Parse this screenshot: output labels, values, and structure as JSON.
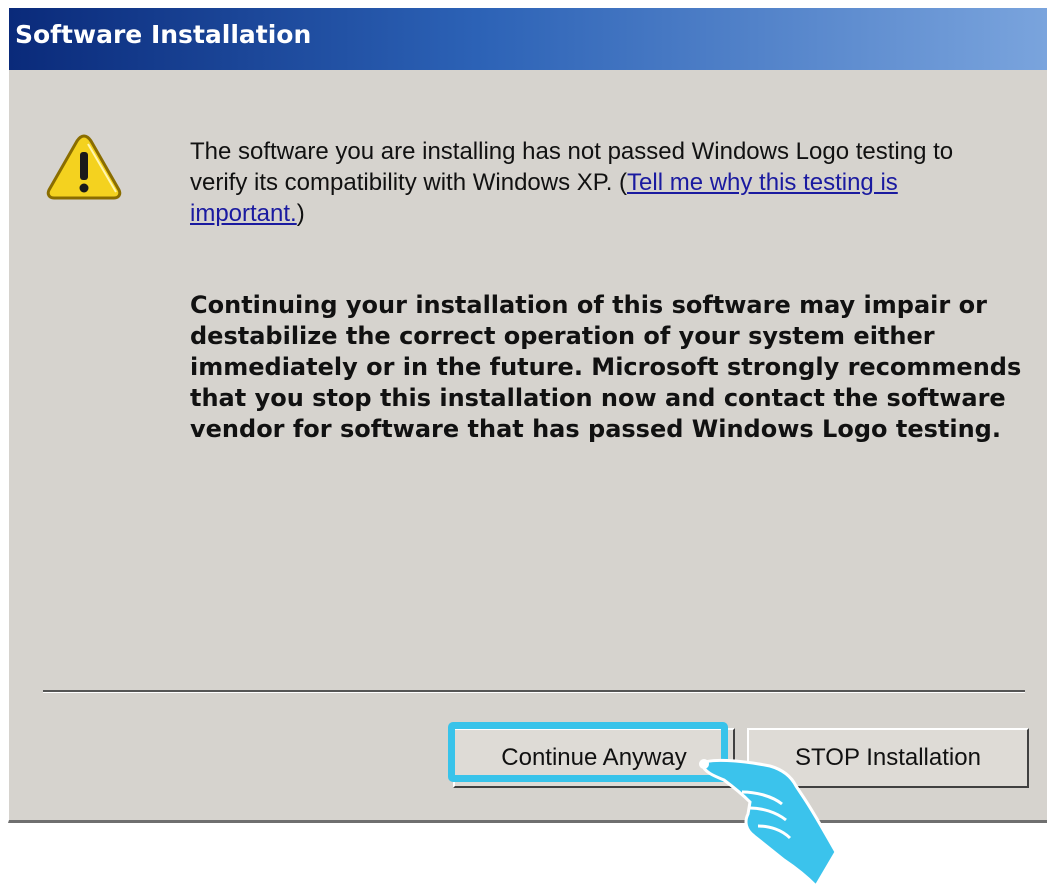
{
  "dialog": {
    "title": "Software Installation",
    "message_text": "The software you are installing has not passed Windows Logo testing to verify its compatibility with Windows XP. (",
    "message_link": "Tell me why this testing is important.",
    "message_close": ")",
    "warning_text": "Continuing your installation of this software may impair or destabilize the correct operation of your system either immediately or in the future. Microsoft strongly recommends that you stop this installation now and contact the software vendor for software that has passed Windows Logo testing.",
    "buttons": {
      "continue_label": "Continue Anyway",
      "stop_label": "STOP Installation"
    }
  },
  "icons": {
    "warning": "warning-triangle-icon",
    "pointer": "hand-pointer-icon"
  },
  "colors": {
    "title_gradient_start": "#0a2a7a",
    "title_gradient_end": "#7aa4dd",
    "dialog_background": "#d6d3ce",
    "highlight": "#38c3ea",
    "link": "#1a1aa0"
  }
}
